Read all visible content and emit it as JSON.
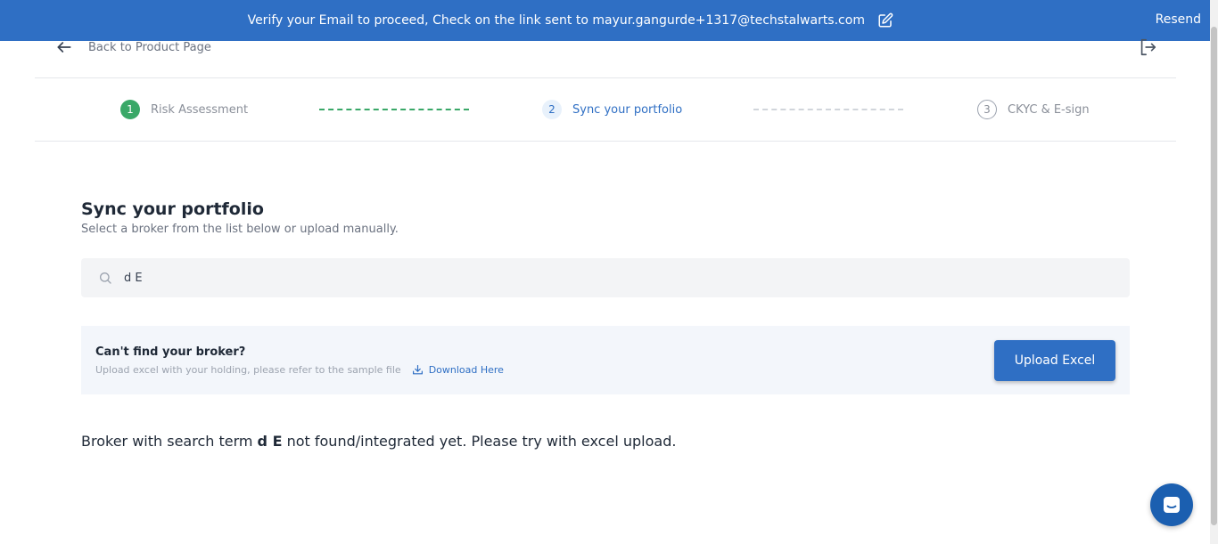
{
  "banner": {
    "message": "Verify your Email to proceed, Check on the link sent to mayur.gangurde+1317@techstalwarts.com",
    "resend_label": "Resend",
    "color": "#2f6fc4"
  },
  "nav": {
    "back_label": "Back to Product Page",
    "back_icon": "arrow-left-icon",
    "logout_icon": "logout-icon"
  },
  "stepper": {
    "steps": [
      {
        "number": "1",
        "label": "Risk Assessment",
        "status": "completed"
      },
      {
        "number": "2",
        "label": "Sync your portfolio",
        "status": "active"
      },
      {
        "number": "3",
        "label": "CKYC & E-sign",
        "status": "pending"
      }
    ],
    "completed_color": "#3aa868",
    "active_color": "#2f6fc4"
  },
  "main": {
    "title": "Sync your portfolio",
    "subtitle": "Select a broker from the list below or upload manually.",
    "search": {
      "value": "d E",
      "placeholder": ""
    },
    "upload_card": {
      "title": "Can't find your broker?",
      "hint": "Upload excel with your holding,  please refer to the sample file",
      "download_label": "Download Here",
      "button_label": "Upload Excel"
    },
    "result": {
      "prefix": "Broker with search term ",
      "term": "d E",
      "suffix": " not found/integrated yet. Please try with excel upload."
    }
  },
  "chat": {
    "icon": "chat-icon"
  }
}
